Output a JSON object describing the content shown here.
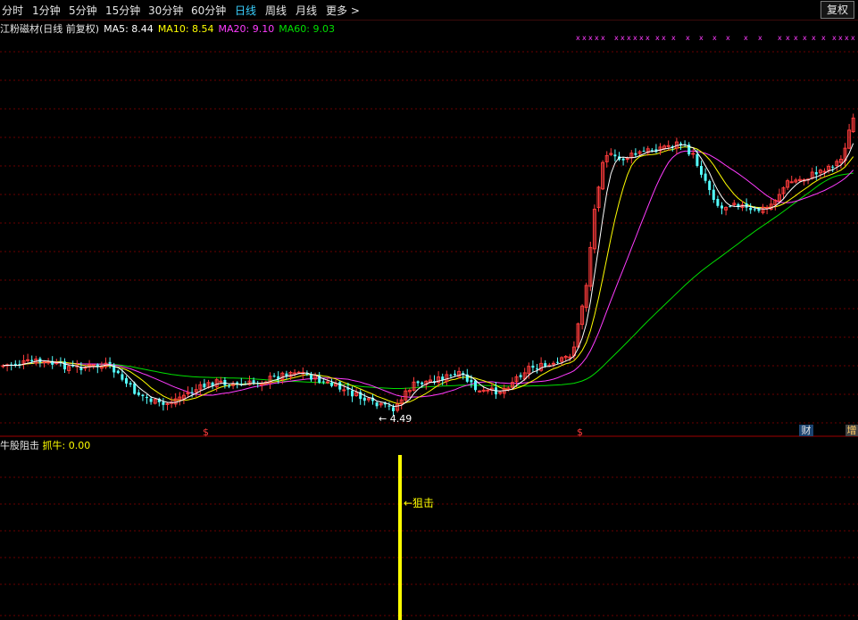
{
  "toolbar": {
    "items": [
      "分时",
      "1分钟",
      "5分钟",
      "15分钟",
      "30分钟",
      "60分钟",
      "日线",
      "周线",
      "月线",
      "更多"
    ],
    "active_index": 6,
    "more_arrow": ">",
    "restore_button": "复权"
  },
  "legend": {
    "title": "江粉磁材(日线 前复权)",
    "ma5": "MA5: 8.44",
    "ma10": "MA10: 8.54",
    "ma20": "MA20: 9.10",
    "ma60": "MA60: 9.03"
  },
  "markers": {
    "low_price": "4.49",
    "dollar_a": "$",
    "dollar_b": "$",
    "finance": "财",
    "increase": "增"
  },
  "indicator": {
    "name": "牛股阻击",
    "value": "抓牛: 0.00",
    "annotation": "←狙击"
  },
  "colors": {
    "background": "#000000",
    "candle_up": "#ff3c3c",
    "candle_down": "#54ffff",
    "ma5": "#ffffff",
    "ma10": "#ffff00",
    "ma20": "#ff3cff",
    "ma60": "#00e000",
    "grid": "#7a0000",
    "active_tab": "#3ad0ff",
    "indicator_bar": "#ffff00"
  }
}
